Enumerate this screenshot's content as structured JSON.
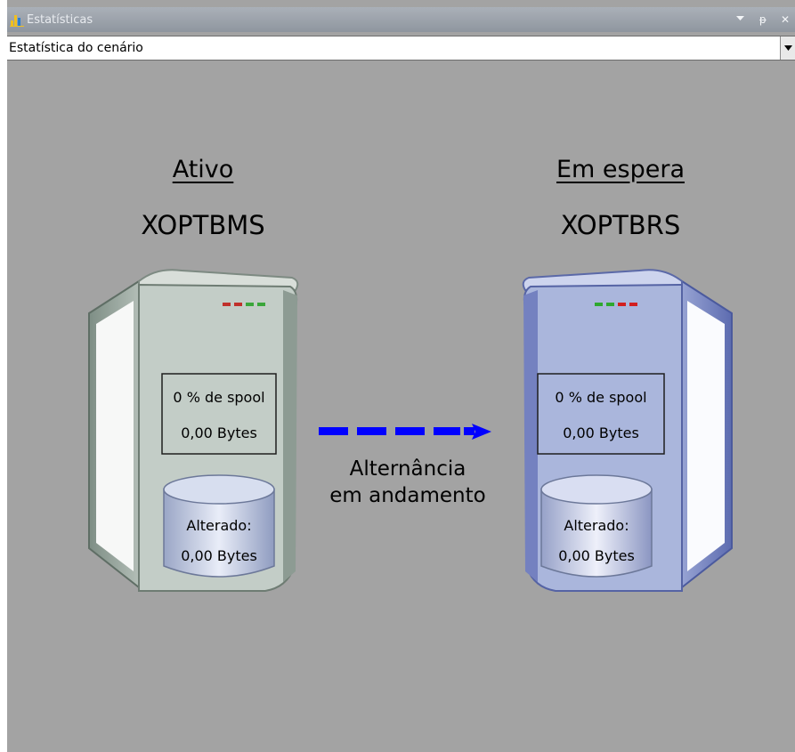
{
  "window": {
    "title": "Estatísticas",
    "pin_label": "ᵽ",
    "close_label": "✕"
  },
  "scenario_select": {
    "value": "Estatística do cenário"
  },
  "active": {
    "role": "Ativo",
    "host": "XOPTBMS",
    "spool": "0 % de spool",
    "spool_size": "0,00 Bytes",
    "changed_label": "Alterado:",
    "changed_size": "0,00 Bytes",
    "led_colors": [
      "#c0302b",
      "#c0302b",
      "#3aa63a",
      "#3aa63a"
    ]
  },
  "standby": {
    "role": "Em espera",
    "host": "XOPTBRS",
    "spool": "0 % de spool",
    "spool_size": "0,00 Bytes",
    "changed_label": "Alterado:",
    "changed_size": "0,00 Bytes",
    "led_colors": [
      "#2ea82e",
      "#2ea82e",
      "#d21f1f",
      "#d21f1f"
    ]
  },
  "transfer": {
    "line1": "Alternância",
    "line2": "em andamento",
    "arrow_color": "#0000ff"
  },
  "colors": {
    "background": "#a3a3a3",
    "active_server": "#c3cdc7",
    "standby_server": "#aab6dc"
  }
}
